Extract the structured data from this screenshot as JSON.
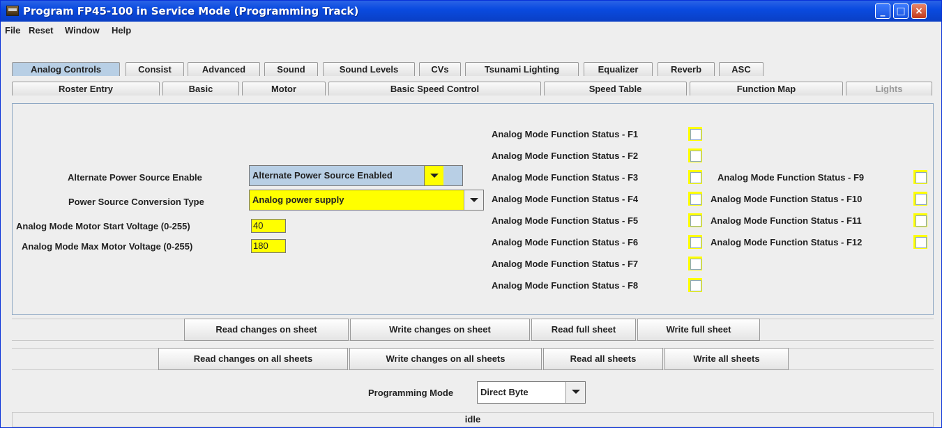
{
  "window": {
    "title": "Program FP45-100 in Service Mode (Programming Track)",
    "minimize": "_",
    "maximize": "□",
    "close": "×"
  },
  "menu": [
    "File",
    "Reset",
    "Window",
    "Help"
  ],
  "tabs_top": [
    "Analog Controls",
    "Consist",
    "Advanced",
    "Sound",
    "Sound Levels",
    "CVs",
    "Tsunami Lighting",
    "Equalizer",
    "Reverb",
    "ASC"
  ],
  "tabs_bottom": [
    "Roster Entry",
    "Basic",
    "Motor",
    "Basic Speed Control",
    "Speed Table",
    "Function Map",
    "Lights"
  ],
  "form": {
    "alt_power_label": "Alternate Power Source Enable",
    "alt_power_value": "Alternate Power Source Enabled",
    "conversion_label": "Power Source Conversion Type",
    "conversion_value": "Analog power supply",
    "start_voltage_label": "Analog Mode Motor Start Voltage (0-255)",
    "start_voltage_value": "40",
    "max_voltage_label": "Analog Mode Max Motor Voltage (0-255)",
    "max_voltage_value": "180"
  },
  "functions": [
    "Analog Mode Function Status - F1",
    "Analog Mode Function Status - F2",
    "Analog Mode Function Status - F3",
    "Analog Mode Function Status - F4",
    "Analog Mode Function Status - F5",
    "Analog Mode Function Status - F6",
    "Analog Mode Function Status - F7",
    "Analog Mode Function Status - F8",
    "Analog Mode Function Status - F9",
    "Analog Mode Function Status - F10",
    "Analog Mode Function Status - F11",
    "Analog Mode Function Status - F12"
  ],
  "buttons": {
    "read_changes_sheet": "Read changes on sheet",
    "write_changes_sheet": "Write changes on sheet",
    "read_full_sheet": "Read full sheet",
    "write_full_sheet": "Write full sheet",
    "read_changes_all": "Read changes on all sheets",
    "write_changes_all": "Write changes on all sheets",
    "read_all": "Read all sheets",
    "write_all": "Write all sheets"
  },
  "programming": {
    "label": "Programming Mode",
    "value": "Direct Byte"
  },
  "status": "idle",
  "colors": {
    "field_highlight": "#ffff00",
    "selected_tab": "#b8cfe5",
    "titlebar": "#0a4be0"
  }
}
